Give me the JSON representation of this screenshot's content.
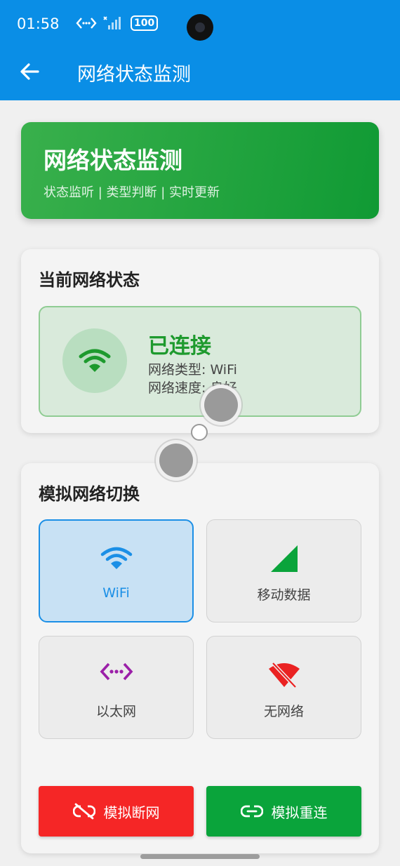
{
  "status_bar": {
    "time": "01:58",
    "battery": "100"
  },
  "app_bar": {
    "title": "网络状态监测"
  },
  "hero": {
    "title": "网络状态监测",
    "subtitle": "状态监听 | 类型判断 | 实时更新"
  },
  "current": {
    "title": "当前网络状态",
    "status": "已连接",
    "type_line": "网络类型: WiFi",
    "speed_line": "网络速度: 良好"
  },
  "simulate": {
    "title": "模拟网络切换",
    "options": [
      {
        "label": "WiFi",
        "icon": "wifi-icon",
        "selected": true
      },
      {
        "label": "移动数据",
        "icon": "cellular-signal-icon",
        "selected": false
      },
      {
        "label": "以太网",
        "icon": "ethernet-icon",
        "selected": false
      },
      {
        "label": "无网络",
        "icon": "wifi-off-icon",
        "selected": false
      }
    ],
    "disconnect_label": "模拟断网",
    "reconnect_label": "模拟重连"
  },
  "colors": {
    "app_bar": "#0a8ee6",
    "hero": "#22a43e",
    "connected": "#1e9a2e",
    "selected": "#1b8fe6",
    "danger": "#f52626",
    "success": "#0aa43b",
    "ethernet": "#9b1fa8",
    "no_network": "#ea2222"
  }
}
